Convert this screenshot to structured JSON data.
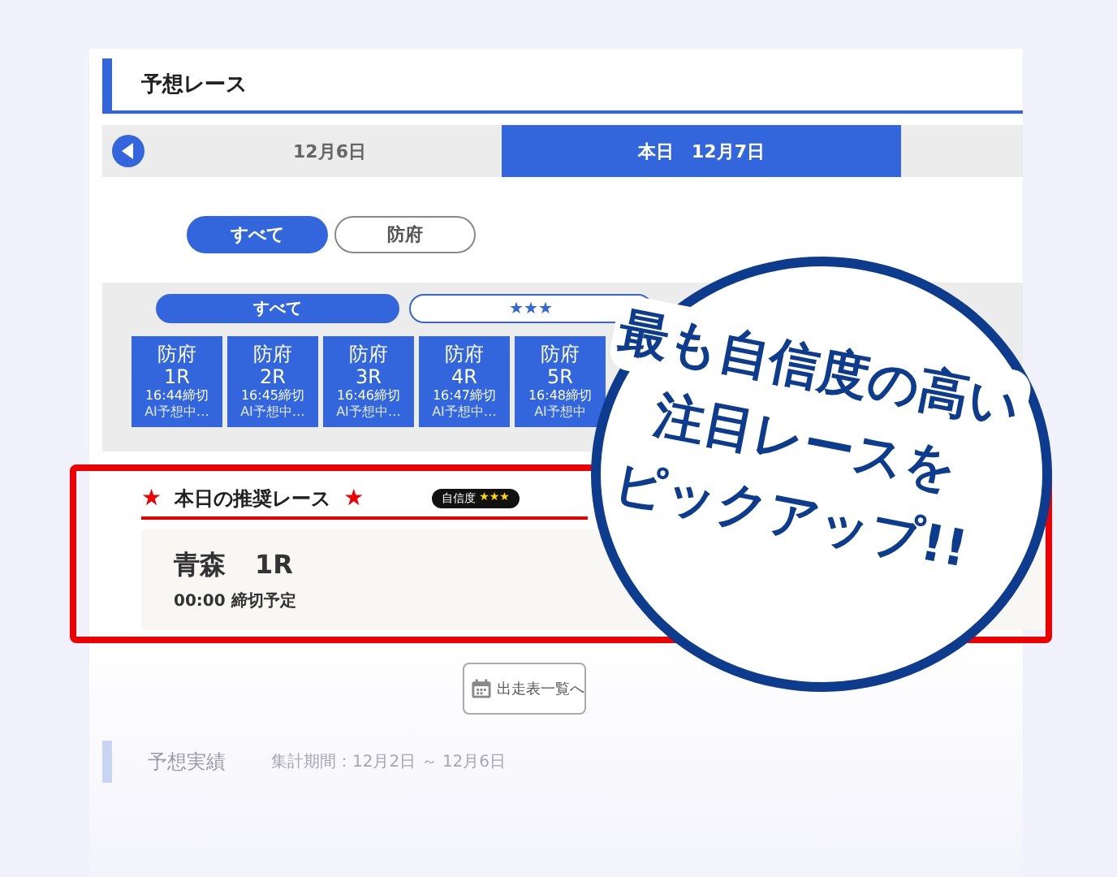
{
  "section": {
    "title": "予想レース"
  },
  "date_tabs": [
    {
      "label": "12月6日",
      "selected": false
    },
    {
      "label": "本日　12月7日",
      "selected": true
    }
  ],
  "venue_filters": [
    {
      "label": "すべて",
      "selected": true
    },
    {
      "label": "防府",
      "selected": false
    }
  ],
  "grade_filters": [
    {
      "label": "すべて",
      "selected": true
    },
    {
      "label": "★★★",
      "selected": false
    }
  ],
  "races": [
    {
      "venue": "防府",
      "race": "1R",
      "deadline": "16:44締切",
      "status": "AI予想中…"
    },
    {
      "venue": "防府",
      "race": "2R",
      "deadline": "16:45締切",
      "status": "AI予想中…"
    },
    {
      "venue": "防府",
      "race": "3R",
      "deadline": "16:46締切",
      "status": "AI予想中…"
    },
    {
      "venue": "防府",
      "race": "4R",
      "deadline": "16:47締切",
      "status": "AI予想中…"
    },
    {
      "venue": "防府",
      "race": "5R",
      "deadline": "16:48締切",
      "status": "AI予想中"
    }
  ],
  "recommended": {
    "mark_left": "★",
    "title": "本日の推奨レース",
    "mark_right": "★",
    "confidence_label": "自信度",
    "confidence_stars": "★★★",
    "venue": "青森",
    "race": "1R",
    "deadline": "00:00 締切予定"
  },
  "list_button": {
    "label": "出走表一覧へ"
  },
  "results": {
    "title": "予想実績",
    "period": "集計期間：12月2日 ～ 12月6日"
  },
  "callout": {
    "lines": [
      "最も自信度の高い",
      "注目レースを",
      "ピックアップ!!"
    ]
  }
}
